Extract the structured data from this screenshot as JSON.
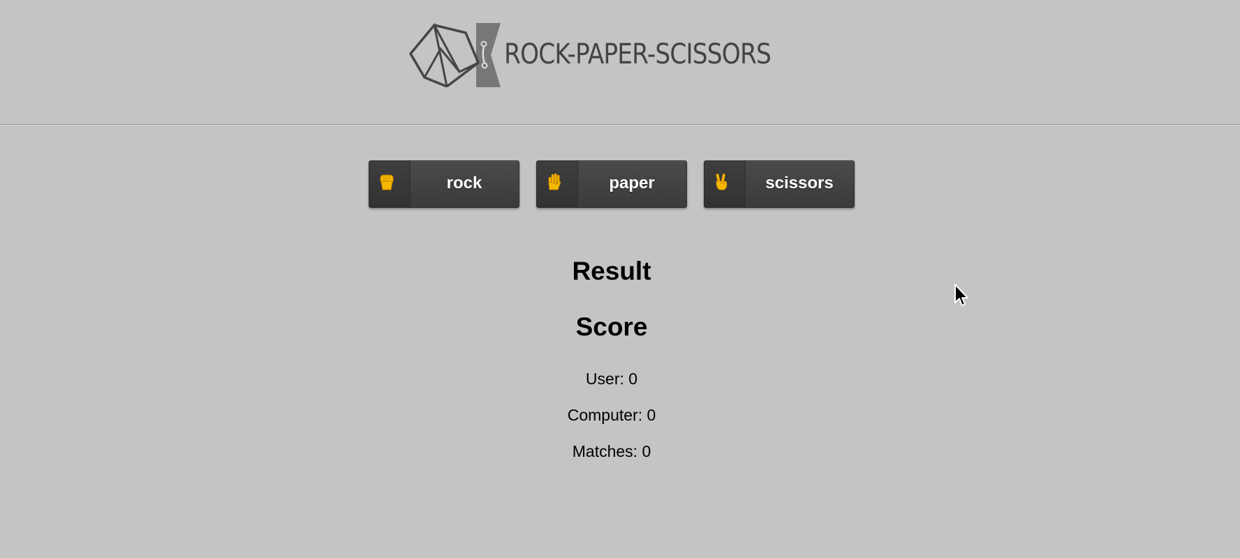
{
  "header": {
    "logo_text": "ROCK-PAPER-SCISSORS",
    "logo_icon": "geometric-rock-scissors-logo-icon"
  },
  "choices": [
    {
      "label": "rock",
      "icon": "raised-fist-icon"
    },
    {
      "label": "paper",
      "icon": "raised-hand-icon"
    },
    {
      "label": "scissors",
      "icon": "victory-hand-icon"
    }
  ],
  "result": {
    "heading": "Result"
  },
  "score": {
    "heading": "Score",
    "user": "User: 0",
    "computer": "Computer: 0",
    "matches": "Matches: 0"
  },
  "colors": {
    "background": "#c4c4c4",
    "button": "#444444",
    "logo": "#444444",
    "emoji": "#f5b800"
  }
}
